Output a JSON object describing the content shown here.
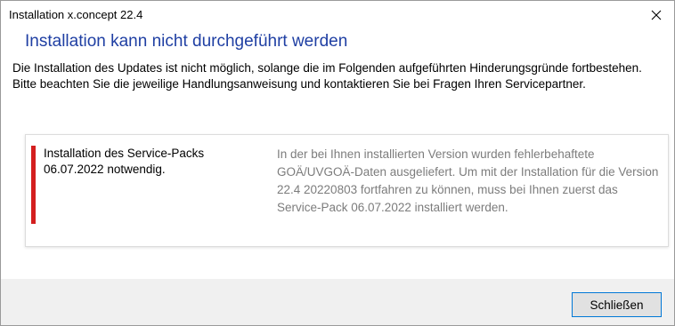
{
  "window": {
    "title": "Installation x.concept 22.4",
    "close_icon": "close-icon"
  },
  "main": {
    "heading": "Installation kann nicht durchgeführt werden",
    "description": "Die Installation des Updates ist nicht möglich, solange die im Folgenden aufgeführten Hinderungsgründe fortbestehen. Bitte beachten Sie die jeweilige Handlungsanweisung und kontaktieren Sie bei Fragen Ihren Servicepartner.",
    "reasons": [
      {
        "title": "Installation des Service-Packs 06.07.2022 notwendig.",
        "detail": "In der bei Ihnen installierten Version wurden fehlerbehaftete GOÄ/UVGOÄ-Daten ausgeliefert.  Um mit der Installation für die Version  22.4 20220803 fortfahren zu können, muss bei Ihnen zuerst das Service-Pack 06.07.2022 installiert werden.",
        "status_color": "#d41f1f"
      }
    ]
  },
  "footer": {
    "close_button_label": "Schließen"
  },
  "colors": {
    "heading": "#1f3fa3",
    "detail_text": "#7c7c7c",
    "footer_bg": "#f0f0f0",
    "button_border": "#0078d7"
  }
}
